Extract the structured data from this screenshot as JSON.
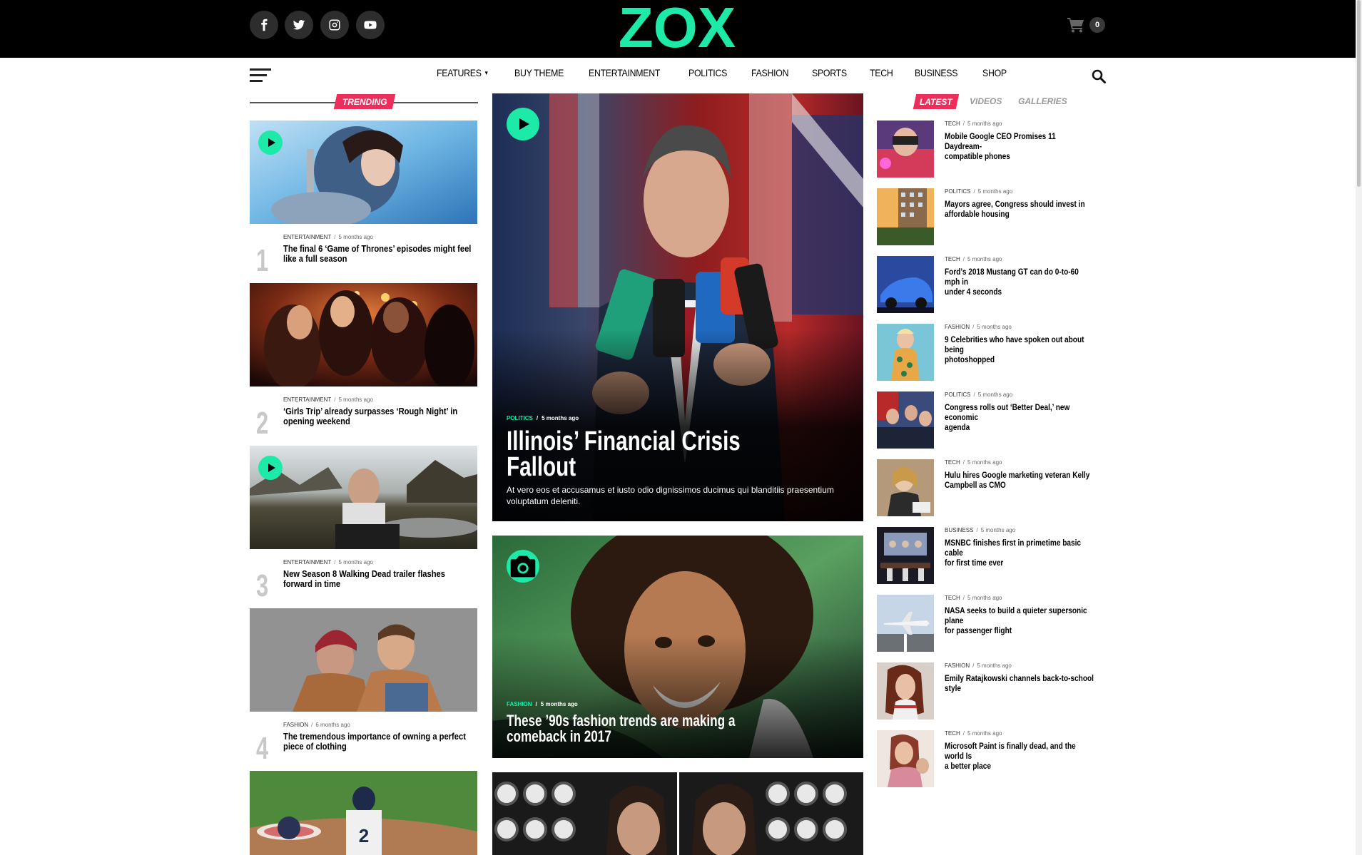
{
  "header": {
    "logo_text": "ZOX",
    "brand_color": "#1de9a9",
    "social": [
      "facebook-icon",
      "twitter-icon",
      "instagram-icon",
      "youtube-icon"
    ],
    "cart_count": "0"
  },
  "nav": {
    "items": [
      {
        "label": "FEATURES",
        "has_dropdown": true
      },
      {
        "label": "BUY THEME"
      },
      {
        "label": "ENTERTAINMENT"
      },
      {
        "label": "POLITICS"
      },
      {
        "label": "FASHION"
      },
      {
        "label": "SPORTS"
      },
      {
        "label": "TECH"
      },
      {
        "label": "BUSINESS"
      },
      {
        "label": "SHOP"
      }
    ]
  },
  "trending": {
    "heading": "TRENDING",
    "items": [
      {
        "num": "1",
        "category": "ENTERTAINMENT",
        "time": "5 months ago",
        "title": "The final 6 ‘Game of Thrones’ episodes might feel like a full season",
        "video": true
      },
      {
        "num": "2",
        "category": "ENTERTAINMENT",
        "time": "5 months ago",
        "title": "‘Girls Trip’ already surpasses ‘Rough Night’ in opening weekend",
        "video": false
      },
      {
        "num": "3",
        "category": "ENTERTAINMENT",
        "time": "5 months ago",
        "title": "New Season 8 Walking Dead trailer flashes forward in time",
        "video": true
      },
      {
        "num": "4",
        "category": "FASHION",
        "time": "6 months ago",
        "title": "The tremendous importance of owning a perfect piece of clothing",
        "video": false
      }
    ]
  },
  "feature_main": {
    "category": "POLITICS",
    "time": "5 months ago",
    "title_line1": "Illinois’ Financial Crisis",
    "title_line2": "Fallout",
    "excerpt_line1": "At vero eos et accusamus et iusto odio dignissimos ducimus qui blanditiis praesentium",
    "excerpt_line2": "voluptatum deleniti."
  },
  "feature_second": {
    "category": "FASHION",
    "time": "5 months ago",
    "title_line1": "These ’90s fashion trends are making a",
    "title_line2": "comeback in 2017"
  },
  "latest": {
    "tabs": [
      "LATEST",
      "VIDEOS",
      "GALLERIES"
    ],
    "items": [
      {
        "category": "TECH",
        "time": "5 months ago",
        "title_line1": "Mobile Google CEO Promises 11 Daydream-",
        "title_line2": "compatible phones"
      },
      {
        "category": "POLITICS",
        "time": "5 months ago",
        "title_line1": "Mayors agree, Congress should invest in",
        "title_line2": "affordable housing"
      },
      {
        "category": "TECH",
        "time": "5 months ago",
        "title_line1": "Ford’s 2018 Mustang GT can do 0-to-60 mph in",
        "title_line2": "under 4 seconds"
      },
      {
        "category": "FASHION",
        "time": "5 months ago",
        "title_line1": "9 Celebrities who have spoken out about being",
        "title_line2": "photoshopped"
      },
      {
        "category": "POLITICS",
        "time": "5 months ago",
        "title_line1": "Congress rolls out ‘Better Deal,’ new economic",
        "title_line2": "agenda"
      },
      {
        "category": "TECH",
        "time": "5 months ago",
        "title_line1": "Hulu hires Google marketing veteran Kelly",
        "title_line2": "Campbell as CMO"
      },
      {
        "category": "BUSINESS",
        "time": "5 months ago",
        "title_line1": "MSNBC finishes first in primetime basic cable",
        "title_line2": "for first time ever"
      },
      {
        "category": "TECH",
        "time": "5 months ago",
        "title_line1": "NASA seeks to build a quieter supersonic plane",
        "title_line2": "for passenger flight"
      },
      {
        "category": "FASHION",
        "time": "5 months ago",
        "title_line1": "Emily Ratajkowski channels back-to-school",
        "title_line2": "style"
      },
      {
        "category": "TECH",
        "time": "5 months ago",
        "title_line1": "Microsoft Paint is finally dead, and the world Is",
        "title_line2": "a better place"
      }
    ]
  }
}
